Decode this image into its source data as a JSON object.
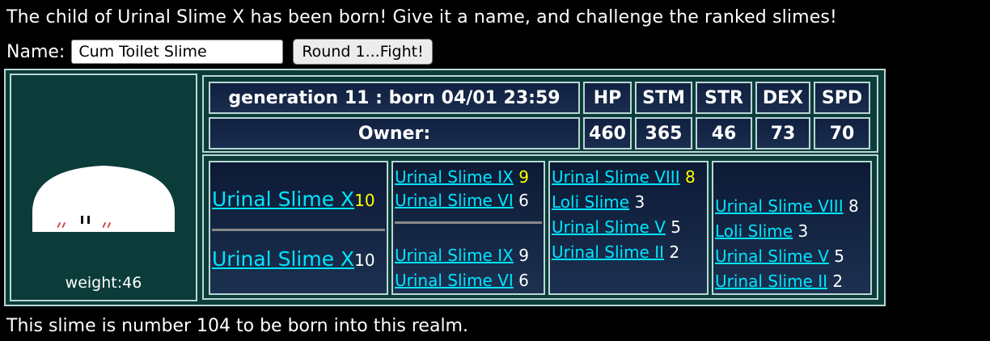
{
  "heading": "The child of Urinal Slime X has been born! Give it a name, and challenge the ranked slimes!",
  "name_form": {
    "label": "Name:",
    "value": "Cum Toilet Slime",
    "button": "Round 1...Fight!"
  },
  "portrait": {
    "weight": "weight:46"
  },
  "stats": {
    "generation": "generation 11 : born 04/01 23:59",
    "owner": "Owner:",
    "headers": [
      "HP",
      "STM",
      "STR",
      "DEX",
      "SPD"
    ],
    "values": [
      "460",
      "365",
      "46",
      "73",
      "70"
    ]
  },
  "pedigree": {
    "parent1": {
      "name": "Urinal Slime X",
      "num": "10"
    },
    "parent2": {
      "name": "Urinal Slime X",
      "num": "10"
    },
    "col2": [
      {
        "name": "Urinal Slime IX",
        "num": "9"
      },
      {
        "name": "Urinal Slime VI",
        "num": "6"
      },
      {
        "name": "Urinal Slime IX",
        "num": "9"
      },
      {
        "name": "Urinal Slime VI",
        "num": "6"
      }
    ],
    "col3": [
      {
        "name": "Urinal Slime VIII",
        "num": "8"
      },
      {
        "name": "Loli Slime",
        "num": "3"
      },
      {
        "name": "Urinal Slime V",
        "num": "5"
      },
      {
        "name": "Urinal Slime II",
        "num": "2"
      }
    ],
    "col4": [
      {
        "name": "Urinal Slime VIII",
        "num": "8"
      },
      {
        "name": "Loli Slime",
        "num": "3"
      },
      {
        "name": "Urinal Slime V",
        "num": "5"
      },
      {
        "name": "Urinal Slime II",
        "num": "2"
      }
    ]
  },
  "footer": "This slime is number 104 to be born into this realm.",
  "colors": {
    "link": "#00e5ff",
    "highlight": "#ffff00",
    "frame": "#0b3c3a",
    "border": "#b9d6d4"
  }
}
